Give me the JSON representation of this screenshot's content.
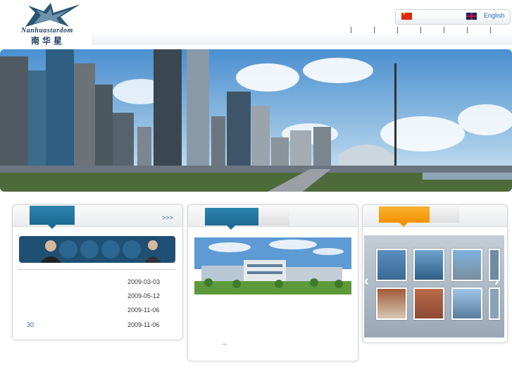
{
  "header": {
    "logo_text": "Nanhuastardom",
    "logo_cn": "南华星",
    "lang_en": "English",
    "nav_separator_count": 7
  },
  "news": {
    "more_link": ">>>",
    "items": [
      {
        "title": "",
        "date": "2009-03-03"
      },
      {
        "title": "",
        "date": "2009-05-12"
      },
      {
        "title": "",
        "date": "2009-11-06"
      },
      {
        "title": "30",
        "date": "2009-11-06"
      }
    ]
  },
  "company": {
    "ellipsis": "..."
  },
  "gallery": {
    "prev_icon": "chevron-left-icon",
    "next_icon": "chevron-right-icon"
  },
  "colors": {
    "tab_blue": "#1b6a93",
    "tab_orange": "#f39200",
    "link": "#2a6fb0"
  }
}
